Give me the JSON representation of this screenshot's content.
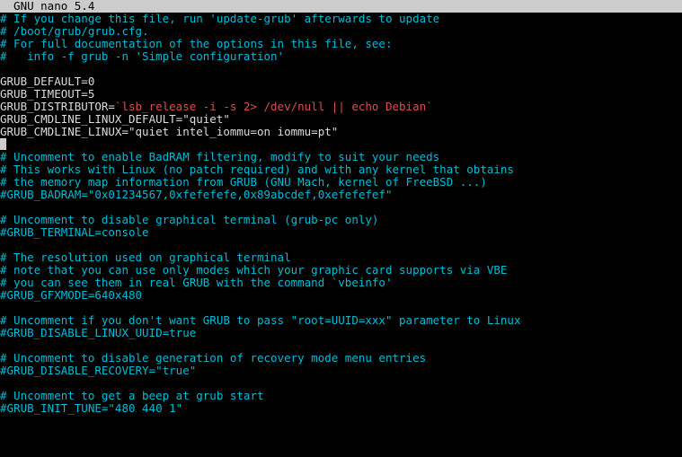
{
  "titlebar": "  GNU nano 5.4",
  "lines": [
    {
      "segments": [
        {
          "cls": "cyan",
          "text": "# If you change this file, run 'update-grub' afterwards to update"
        }
      ]
    },
    {
      "segments": [
        {
          "cls": "cyan",
          "text": "# /boot/grub/grub.cfg."
        }
      ]
    },
    {
      "segments": [
        {
          "cls": "cyan",
          "text": "# For full documentation of the options in this file, see:"
        }
      ]
    },
    {
      "segments": [
        {
          "cls": "cyan",
          "text": "#   info -f grub -n 'Simple configuration'"
        }
      ]
    },
    {
      "segments": []
    },
    {
      "segments": [
        {
          "cls": "white",
          "text": "GRUB_DEFAULT=0"
        }
      ]
    },
    {
      "segments": [
        {
          "cls": "white",
          "text": "GRUB_TIMEOUT=5"
        }
      ]
    },
    {
      "segments": [
        {
          "cls": "white",
          "text": "GRUB_DISTRIBUTOR="
        },
        {
          "cls": "red",
          "text": "`lsb_release -i -s 2> /dev/null || echo Debian`"
        }
      ]
    },
    {
      "segments": [
        {
          "cls": "white",
          "text": "GRUB_CMDLINE_LINUX_DEFAULT=\"quiet\""
        }
      ]
    },
    {
      "segments": [
        {
          "cls": "white",
          "text": "GRUB_CMDLINE_LINUX=\"quiet intel_iommu=on iommu=pt\""
        }
      ]
    },
    {
      "cursor": true,
      "segments": []
    },
    {
      "segments": [
        {
          "cls": "cyan",
          "text": "# Uncomment to enable BadRAM filtering, modify to suit your needs"
        }
      ]
    },
    {
      "segments": [
        {
          "cls": "cyan",
          "text": "# This works with Linux (no patch required) and with any kernel that obtains"
        }
      ]
    },
    {
      "segments": [
        {
          "cls": "cyan",
          "text": "# the memory map information from GRUB (GNU Mach, kernel of FreeBSD ...)"
        }
      ]
    },
    {
      "segments": [
        {
          "cls": "cyan",
          "text": "#GRUB_BADRAM=\"0x01234567,0xfefefefe,0x89abcdef,0xefefefef\""
        }
      ]
    },
    {
      "segments": []
    },
    {
      "segments": [
        {
          "cls": "cyan",
          "text": "# Uncomment to disable graphical terminal (grub-pc only)"
        }
      ]
    },
    {
      "segments": [
        {
          "cls": "cyan",
          "text": "#GRUB_TERMINAL=console"
        }
      ]
    },
    {
      "segments": []
    },
    {
      "segments": [
        {
          "cls": "cyan",
          "text": "# The resolution used on graphical terminal"
        }
      ]
    },
    {
      "segments": [
        {
          "cls": "cyan",
          "text": "# note that you can use only modes which your graphic card supports via VBE"
        }
      ]
    },
    {
      "segments": [
        {
          "cls": "cyan",
          "text": "# you can see them in real GRUB with the command `vbeinfo'"
        }
      ]
    },
    {
      "segments": [
        {
          "cls": "cyan",
          "text": "#GRUB_GFXMODE=640x480"
        }
      ]
    },
    {
      "segments": []
    },
    {
      "segments": [
        {
          "cls": "cyan",
          "text": "# Uncomment if you don't want GRUB to pass \"root=UUID=xxx\" parameter to Linux"
        }
      ]
    },
    {
      "segments": [
        {
          "cls": "cyan",
          "text": "#GRUB_DISABLE_LINUX_UUID=true"
        }
      ]
    },
    {
      "segments": []
    },
    {
      "segments": [
        {
          "cls": "cyan",
          "text": "# Uncomment to disable generation of recovery mode menu entries"
        }
      ]
    },
    {
      "segments": [
        {
          "cls": "cyan",
          "text": "#GRUB_DISABLE_RECOVERY=\"true\""
        }
      ]
    },
    {
      "segments": []
    },
    {
      "segments": [
        {
          "cls": "cyan",
          "text": "# Uncomment to get a beep at grub start"
        }
      ]
    },
    {
      "segments": [
        {
          "cls": "cyan",
          "text": "#GRUB_INIT_TUNE=\"480 440 1\""
        }
      ]
    }
  ]
}
